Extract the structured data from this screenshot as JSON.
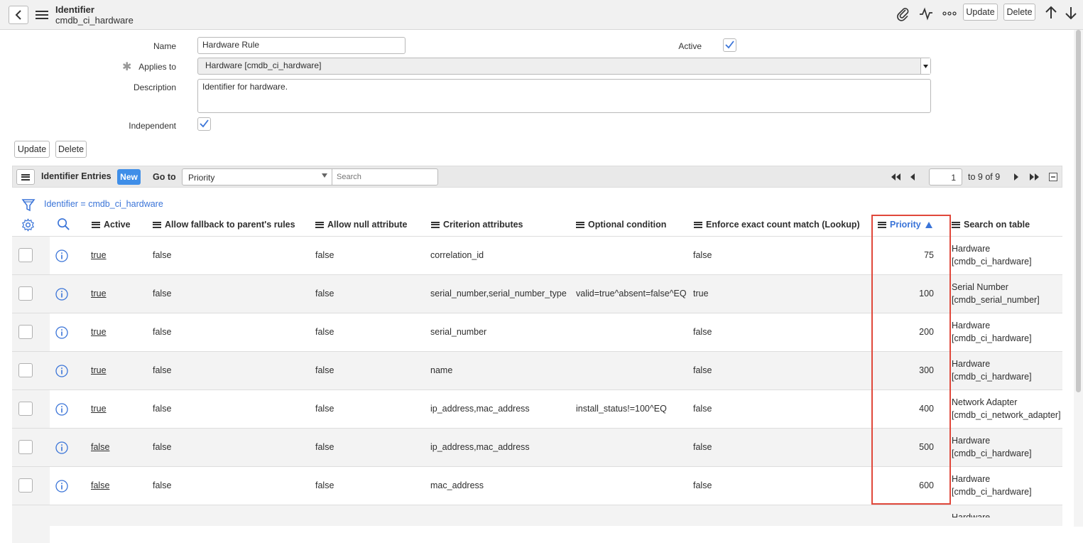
{
  "header": {
    "title": "Identifier",
    "subtitle": "cmdb_ci_hardware",
    "update_label": "Update",
    "delete_label": "Delete"
  },
  "form": {
    "name_label": "Name",
    "name_value": "Hardware Rule",
    "active_label": "Active",
    "active_checked": true,
    "applies_to_label": "Applies to",
    "applies_to_value": "Hardware [cmdb_ci_hardware]",
    "description_label": "Description",
    "description_value": "Identifier for hardware.",
    "independent_label": "Independent",
    "independent_checked": true,
    "update_label": "Update",
    "delete_label": "Delete"
  },
  "list": {
    "title": "Identifier Entries",
    "new_label": "New",
    "goto_label": "Go to",
    "goto_select": "Priority",
    "search_placeholder": "Search",
    "page_input": "1",
    "page_text": "to 9 of 9",
    "filter_text": "Identifier = cmdb_ci_hardware",
    "columns": {
      "active": "Active",
      "fallback": "Allow fallback to parent's rules",
      "null_attr": "Allow null attribute",
      "criterion": "Criterion attributes",
      "optional": "Optional condition",
      "enforce": "Enforce exact count match (Lookup)",
      "priority": "Priority",
      "search": "Search on table"
    },
    "rows": [
      {
        "active": "true",
        "fallback": "false",
        "null_attr": "false",
        "criterion": "correlation_id",
        "optional": "",
        "enforce": "false",
        "priority": "75",
        "search1": "Hardware",
        "search2": "[cmdb_ci_hardware]"
      },
      {
        "active": "true",
        "fallback": "false",
        "null_attr": "false",
        "criterion": "serial_number,serial_number_type",
        "optional": "valid=true^absent=false^EQ",
        "enforce": "true",
        "priority": "100",
        "search1": "Serial Number",
        "search2": "[cmdb_serial_number]"
      },
      {
        "active": "true",
        "fallback": "false",
        "null_attr": "false",
        "criterion": "serial_number",
        "optional": "",
        "enforce": "false",
        "priority": "200",
        "search1": "Hardware",
        "search2": "[cmdb_ci_hardware]"
      },
      {
        "active": "true",
        "fallback": "false",
        "null_attr": "false",
        "criterion": "name",
        "optional": "",
        "enforce": "false",
        "priority": "300",
        "search1": "Hardware",
        "search2": "[cmdb_ci_hardware]"
      },
      {
        "active": "true",
        "fallback": "false",
        "null_attr": "false",
        "criterion": "ip_address,mac_address",
        "optional": "install_status!=100^EQ",
        "enforce": "false",
        "priority": "400",
        "search1": "Network Adapter",
        "search2": "[cmdb_ci_network_adapter]"
      },
      {
        "active": "false",
        "fallback": "false",
        "null_attr": "false",
        "criterion": "ip_address,mac_address",
        "optional": "",
        "enforce": "false",
        "priority": "500",
        "search1": "Hardware",
        "search2": "[cmdb_ci_hardware]"
      },
      {
        "active": "false",
        "fallback": "false",
        "null_attr": "false",
        "criterion": "mac_address",
        "optional": "",
        "enforce": "false",
        "priority": "600",
        "search1": "Hardware",
        "search2": "[cmdb_ci_hardware]"
      },
      {
        "active": "",
        "fallback": "",
        "null_attr": "",
        "criterion": "",
        "optional": "",
        "enforce": "",
        "priority": "",
        "search1": "Hardware",
        "search2": ""
      }
    ]
  },
  "colors": {
    "accent": "#3a74d8",
    "highlight_box": "#e0483b",
    "new_button": "#3f8ee8"
  },
  "icons": [
    "back-icon",
    "menu-icon",
    "paperclip-icon",
    "activity-icon",
    "more-icon",
    "arrow-up-icon",
    "arrow-down-icon",
    "filter-icon",
    "gear-icon",
    "search-icon",
    "info-icon",
    "sort-asc-icon"
  ]
}
